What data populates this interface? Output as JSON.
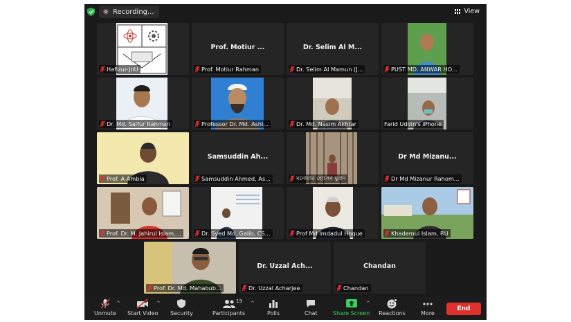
{
  "topbar": {
    "recording_label": "Recording...",
    "view_label": "View"
  },
  "tiles": [
    {
      "caption": "Hafizur-JnU",
      "center_name": ""
    },
    {
      "caption": "Prof.  Motiur Rahman",
      "center_name": "Prof.  Motiur ..."
    },
    {
      "caption": "Dr. Selim Al Mamun (J...",
      "center_name": "Dr. Selim Al M..."
    },
    {
      "caption": "PUST MD. ANWAR HO...",
      "center_name": ""
    },
    {
      "caption": "Dr. Md. Saifur Rahman",
      "center_name": ""
    },
    {
      "caption": "Professor Dr. Md. Ashi...",
      "center_name": ""
    },
    {
      "caption": "Dr. Md. Nasim Akhtar",
      "center_name": ""
    },
    {
      "caption": "Farid Uddin's iPhone",
      "center_name": ""
    },
    {
      "caption": "Prof. A Ambia",
      "center_name": ""
    },
    {
      "caption": "Samsuddin Ahmed, As...",
      "center_name": "Samsuddin Ah..."
    },
    {
      "caption": "মনোয়ার হোসেন মুরাদ",
      "center_name": ""
    },
    {
      "caption": "Dr Md Mizanur Rahom...",
      "center_name": "Dr Md Mizanu..."
    },
    {
      "caption": "Prof. Dr. M. Jahirul Islam,...",
      "center_name": ""
    },
    {
      "caption": "Dr. Syed Md. Galib, CS...",
      "center_name": ""
    },
    {
      "caption": "Prof Md Imdadul Hoque",
      "center_name": ""
    },
    {
      "caption": "Khademul Islam, RU",
      "center_name": ""
    },
    {
      "caption": "Prof. Dr. Md. Mahabub...",
      "center_name": ""
    },
    {
      "caption": "Dr. Uzzal  Acharjee",
      "center_name": "Dr. Uzzal  Ach..."
    },
    {
      "caption": "Chandan",
      "center_name": "Chandan"
    }
  ],
  "toolbar": {
    "unmute": "Unmute",
    "start_video": "Start Video",
    "security": "Security",
    "participants": "Participants",
    "participants_count": "19",
    "polls": "Polls",
    "chat": "Chat",
    "share_screen": "Share Screen",
    "reactions": "Reactions",
    "more": "More",
    "end": "End"
  },
  "colors": {
    "end_button": "#e0322c",
    "share_screen": "#39d05a",
    "speaker_highlight": "#c9e84b",
    "muted_mic": "#e03131"
  }
}
